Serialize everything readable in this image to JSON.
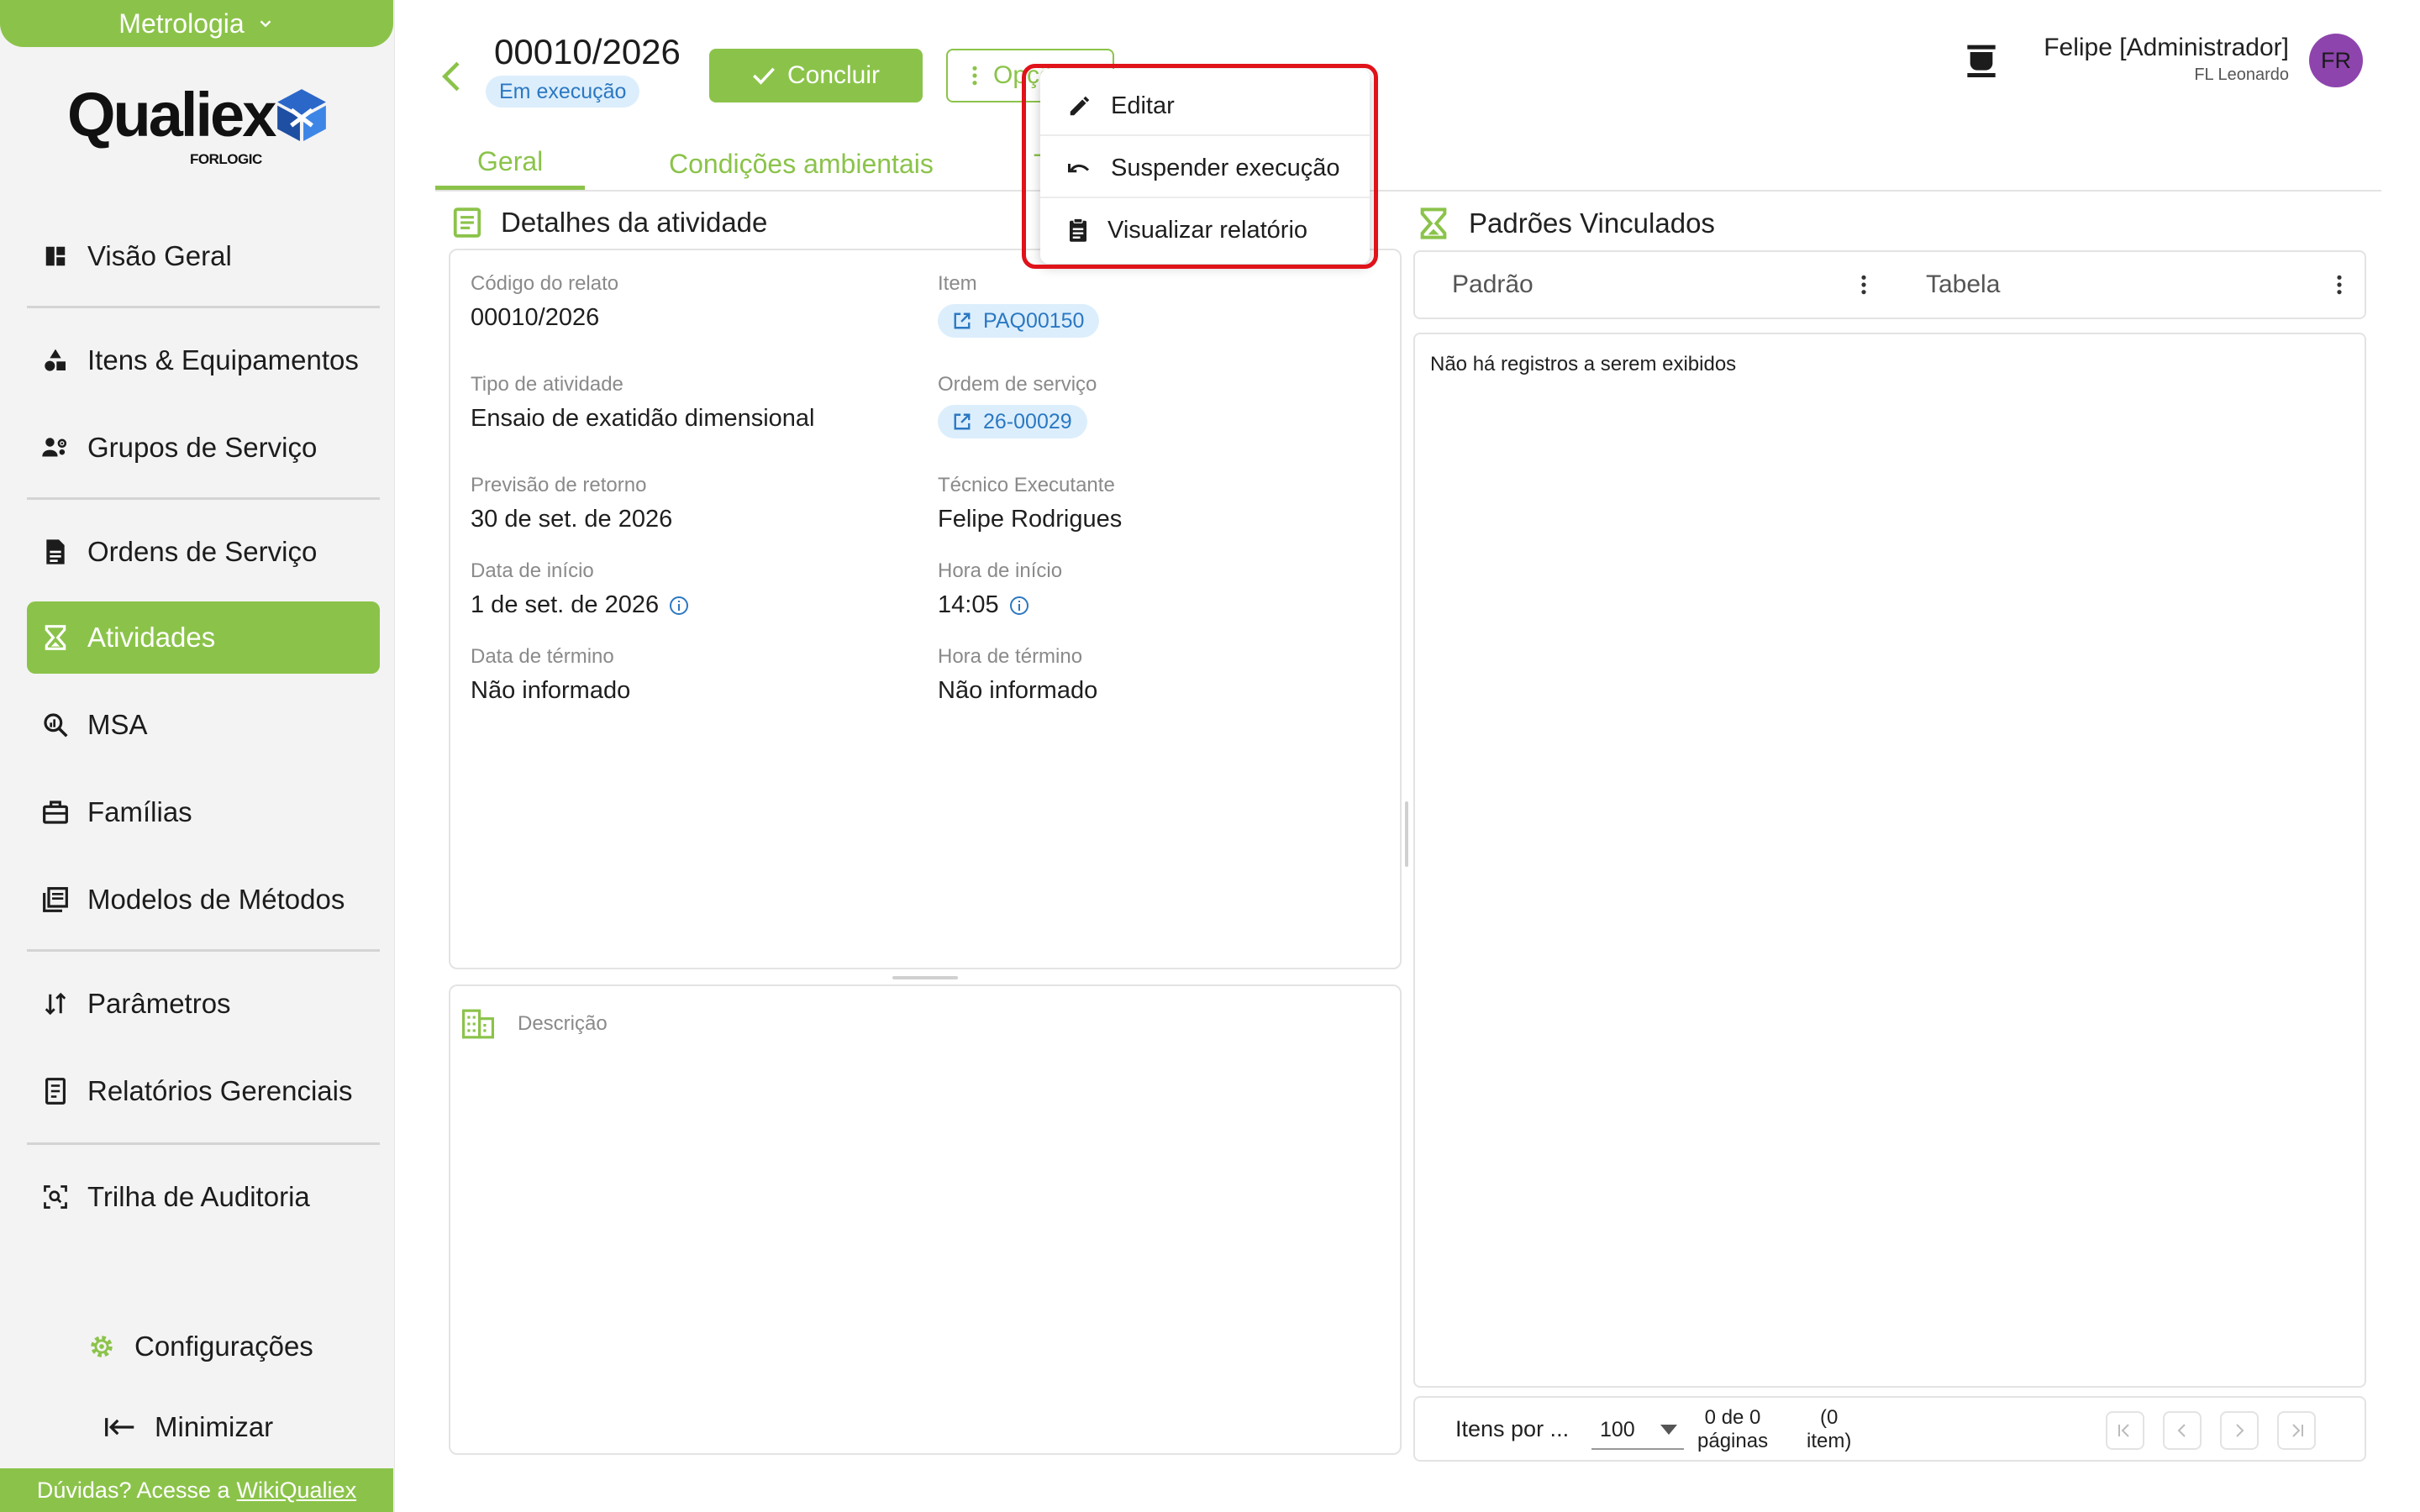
{
  "sidebar": {
    "module_label": "Metrologia",
    "logo_text": "Qualiex",
    "logo_sub": "FORLOGIC",
    "items": [
      {
        "label": "Visão Geral",
        "icon": "dashboard-icon"
      },
      {
        "label": "Itens & Equipamentos",
        "icon": "shapes-icon"
      },
      {
        "label": "Grupos de Serviço",
        "icon": "group-settings-icon"
      },
      {
        "label": "Ordens de Serviço",
        "icon": "document-icon"
      },
      {
        "label": "Atividades",
        "icon": "hourglass-icon",
        "active": true
      },
      {
        "label": "MSA",
        "icon": "query-stats-icon"
      },
      {
        "label": "Famílias",
        "icon": "toolbox-icon"
      },
      {
        "label": "Modelos de Métodos",
        "icon": "library-books-icon"
      },
      {
        "label": "Parâmetros",
        "icon": "sort-arrows-icon"
      },
      {
        "label": "Relatórios Gerenciais",
        "icon": "report-icon"
      },
      {
        "label": "Trilha de Auditoria",
        "icon": "scan-search-icon"
      }
    ],
    "settings_label": "Configurações",
    "minimize_label": "Minimizar",
    "help_text": "Dúvidas? Acesse a",
    "help_link": "WikiQualiex"
  },
  "header": {
    "title": "00010/2026",
    "status": "Em execução",
    "conclude_label": "Concluir",
    "options_label": "Opções",
    "user_name": "Felipe [Administrador]",
    "user_org": "FL Leonardo",
    "avatar_initials": "FR"
  },
  "tabs": [
    "Geral",
    "Condições ambientais",
    "Tabelas"
  ],
  "details": {
    "section_title": "Detalhes da atividade",
    "fields": {
      "codigo_label": "Código do relato",
      "codigo_value": "00010/2026",
      "item_label": "Item",
      "item_value": "PAQ00150",
      "tipo_label": "Tipo de atividade",
      "tipo_value": "Ensaio de exatidão dimensional",
      "ordem_label": "Ordem de serviço",
      "ordem_value": "26-00029",
      "previsao_label": "Previsão de retorno",
      "previsao_value": "30 de set. de 2026",
      "tecnico_label": "Técnico Executante",
      "tecnico_value": "Felipe Rodrigues",
      "data_inicio_label": "Data de início",
      "data_inicio_value": "1 de set. de 2026",
      "hora_inicio_label": "Hora de início",
      "hora_inicio_value": "14:05",
      "data_termino_label": "Data de término",
      "data_termino_value": "Não informado",
      "hora_termino_label": "Hora de término",
      "hora_termino_value": "Não informado"
    },
    "description_label": "Descrição"
  },
  "padroes": {
    "section_title": "Padrões Vinculados",
    "col_padrao": "Padrão",
    "col_tabela": "Tabela",
    "empty_message": "Não há registros a serem exibidos",
    "pager": {
      "items_per_label": "Itens por ...",
      "page_size": "100",
      "count_line1": "0 de 0",
      "count_line2": "páginas",
      "items_line1": "(0",
      "items_line2": "item)"
    }
  },
  "menu": {
    "items": [
      "Editar",
      "Suspender execução",
      "Visualizar relatório"
    ]
  },
  "colors": {
    "brand_green": "#8bc34a",
    "chip_blue": "#2b78c2",
    "highlight_red": "#e0121a",
    "avatar_purple": "#8e44ad"
  }
}
